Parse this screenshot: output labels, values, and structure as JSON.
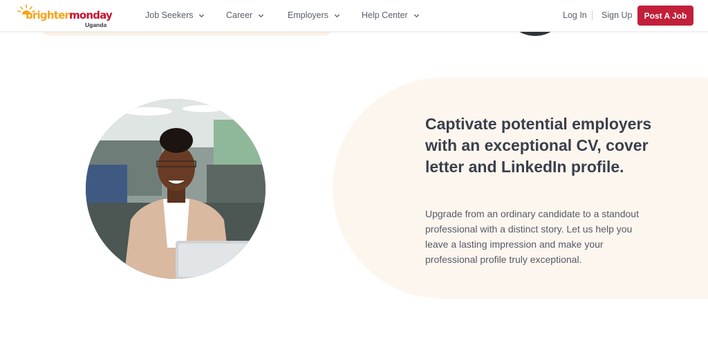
{
  "header": {
    "logo": {
      "brand_part1": "brighter",
      "brand_part2": "monday",
      "region": "Uganda"
    },
    "nav": [
      {
        "label": "Job Seekers",
        "icon": "chevron-down-icon"
      },
      {
        "label": "Career",
        "icon": "chevron-down-icon"
      },
      {
        "label": "Employers",
        "icon": "chevron-down-icon"
      },
      {
        "label": "Help Center",
        "icon": "chevron-down-icon"
      }
    ],
    "login_label": "Log In",
    "signup_label": "Sign Up",
    "post_job_label": "Post A Job"
  },
  "feature": {
    "heading": "Captivate potential employers with an exceptional CV, cover letter and LinkedIn profile.",
    "body": "Upgrade from an ordinary candidate to a standout professional with a distinct story. Let us help you leave a lasting impression and make your professional profile truly exceptional."
  },
  "colors": {
    "brand_orange": "#f5a31a",
    "brand_red": "#c8102e",
    "button_red": "#c21f3a",
    "cream_panel": "#fdf6ef",
    "heading_text": "#3a3f4b"
  }
}
